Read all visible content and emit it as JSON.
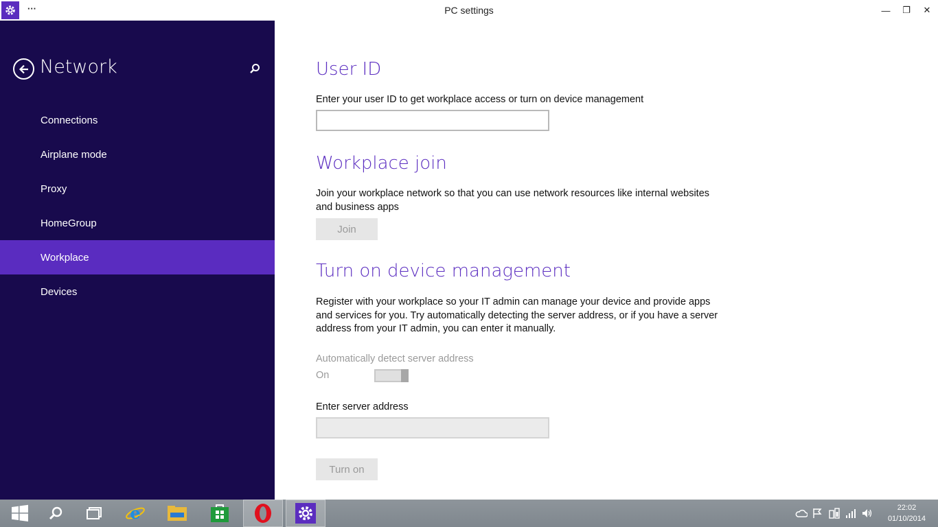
{
  "window": {
    "title": "PC settings",
    "menu_dots": "···",
    "controls": {
      "minimize": "—",
      "restore": "❐",
      "close": "✕"
    }
  },
  "sidebar": {
    "title": "Network",
    "items": [
      {
        "label": "Connections",
        "active": false
      },
      {
        "label": "Airplane mode",
        "active": false
      },
      {
        "label": "Proxy",
        "active": false
      },
      {
        "label": "HomeGroup",
        "active": false
      },
      {
        "label": "Workplace",
        "active": true
      },
      {
        "label": "Devices",
        "active": false
      }
    ]
  },
  "main": {
    "user_id": {
      "heading": "User ID",
      "description": "Enter your user ID to get workplace access or turn on device management",
      "input_value": ""
    },
    "workplace_join": {
      "heading": "Workplace join",
      "description": "Join your workplace network so that you can use network resources like internal websites and business apps",
      "button": "Join"
    },
    "device_management": {
      "heading": "Turn on device management",
      "description": "Register with your workplace so your IT admin can manage your device and provide apps and services for you. Try automatically detecting the server address, or if you have a server address from your IT admin, you can enter it manually.",
      "auto_detect_label": "Automatically detect server address",
      "auto_detect_state": "On",
      "server_address_label": "Enter server address",
      "server_address_value": "",
      "button": "Turn on"
    }
  },
  "taskbar": {
    "apps": [
      "start-icon",
      "search-icon",
      "task-view-icon",
      "internet-explorer-icon",
      "file-explorer-icon",
      "store-icon",
      "opera-icon",
      "pc-settings-icon"
    ],
    "clock_time": "22:02",
    "clock_date": "01/10/2014"
  },
  "colors": {
    "sidebar_bg": "#180a4d",
    "accent": "#5a2cc0"
  }
}
